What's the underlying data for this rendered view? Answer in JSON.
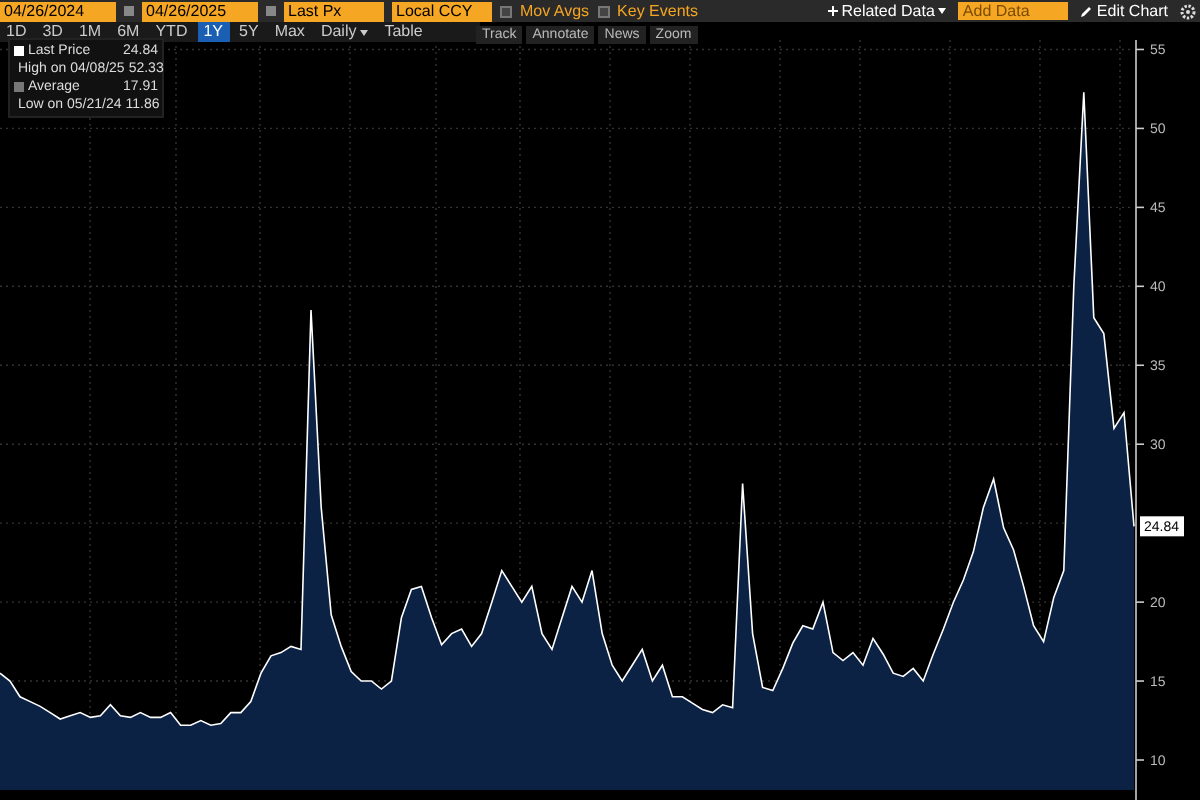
{
  "toolbar": {
    "start_date": "04/26/2024",
    "end_date": "04/26/2025",
    "price_field": "Last Px",
    "currency": "Local CCY",
    "toggles": [
      {
        "label": "Mov Avgs",
        "checked": false
      },
      {
        "label": "Key Events",
        "checked": false
      }
    ],
    "related_data": "Related Data",
    "add_data_placeholder": "Add Data",
    "edit_chart": "Edit Chart"
  },
  "ranges": [
    {
      "label": "1D",
      "selected": false
    },
    {
      "label": "3D",
      "selected": false
    },
    {
      "label": "1M",
      "selected": false
    },
    {
      "label": "6M",
      "selected": false
    },
    {
      "label": "YTD",
      "selected": false
    },
    {
      "label": "1Y",
      "selected": true
    },
    {
      "label": "5Y",
      "selected": false
    },
    {
      "label": "Max",
      "selected": false
    }
  ],
  "frequency": "Daily",
  "table_button": "Table",
  "tools": [
    "Track",
    "Annotate",
    "News",
    "Zoom"
  ],
  "legend": [
    {
      "value": "24.84"
    },
    {
      "label": "High on 04/08/25",
      "value": "52.33"
    },
    {
      "label": "Average",
      "value": "17.91"
    },
    {
      "label": "Low on 05/21/24",
      "value": "11.86"
    }
  ],
  "last_label": "24.84",
  "chart": {
    "chart_data": {
      "type": "area",
      "grid": true,
      "ylim": [
        8.1,
        55.6
      ],
      "yticks": [
        10,
        15,
        20,
        30,
        35,
        40,
        45,
        50,
        55
      ],
      "series": [
        {
          "name": "Last Price",
          "color": "#0b2244",
          "values": [
            15.5,
            15,
            14,
            13.7,
            13.4,
            13,
            12.6,
            12.8,
            13,
            12.7,
            12.8,
            13.5,
            12.8,
            12.7,
            13,
            12.7,
            12.7,
            13,
            12.2,
            12.2,
            12.5,
            12.2,
            12.3,
            13,
            13,
            13.7,
            15.5,
            16.6,
            16.8,
            17.2,
            17,
            38.5,
            26,
            19.2,
            17.2,
            15.6,
            15,
            15,
            14.5,
            15,
            19,
            20.8,
            21,
            19,
            17.3,
            18,
            18.3,
            17.2,
            18,
            20,
            22,
            21,
            20,
            21,
            18,
            17,
            19,
            21,
            20,
            22,
            18,
            16,
            15,
            16,
            17,
            15,
            16,
            14,
            14,
            13.6,
            13.2,
            13,
            13.5,
            13.3,
            27.5,
            18,
            14.6,
            14.4,
            15.8,
            17.4,
            18.5,
            18.3,
            20,
            16.8,
            16.3,
            16.8,
            16,
            17.7,
            16.7,
            15.5,
            15.3,
            15.8,
            15,
            16.7,
            18.3,
            20,
            21.4,
            23.2,
            26,
            27.8,
            24.7,
            23.3,
            21,
            18.5,
            17.5,
            20.3,
            22,
            40,
            52.3,
            38,
            37,
            31,
            32,
            24.8
          ]
        }
      ]
    }
  }
}
